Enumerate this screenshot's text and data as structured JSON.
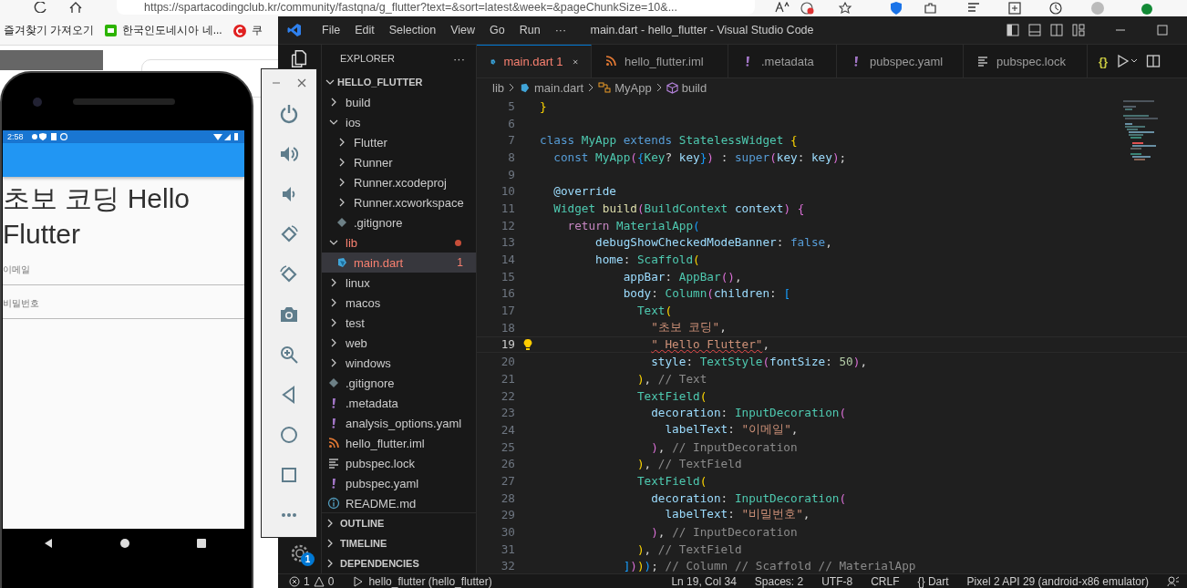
{
  "browser": {
    "url": "https://spartacodingclub.kr/community/fastqna/g_flutter?text=&sort=latest&week=&pageChunkSize=10&...",
    "bookmarks": [
      {
        "label": "즐겨찾기 가져오기",
        "kind": "plain"
      },
      {
        "label": "한국인도네시아 네...",
        "kind": "green"
      },
      {
        "label": "쿠",
        "kind": "red"
      }
    ]
  },
  "phone": {
    "time": "2:58",
    "title": "초보 코딩 Hello Flutter",
    "fields": [
      {
        "label": "이메일"
      },
      {
        "label": "비밀번호"
      }
    ]
  },
  "vscode": {
    "menu": [
      "File",
      "Edit",
      "Selection",
      "View",
      "Go",
      "Run",
      "···"
    ],
    "title": "main.dart - hello_flutter - Visual Studio Code",
    "activity_bar": {
      "settings_badge": "1"
    },
    "explorer": {
      "title": "EXPLORER",
      "more": "···",
      "root": {
        "label": "HELLO_FLUTTER",
        "expanded": true,
        "children": [
          {
            "label": "build",
            "kind": "folder",
            "expanded": false,
            "selected": false,
            "error": false
          },
          {
            "label": "ios",
            "kind": "folder",
            "expanded": true,
            "selected": false,
            "error": false,
            "children": [
              {
                "label": "Flutter",
                "kind": "folder",
                "expanded": false,
                "selected": false,
                "error": false
              },
              {
                "label": "Runner",
                "kind": "folder",
                "expanded": false,
                "selected": false,
                "error": false
              },
              {
                "label": "Runner.xcodeproj",
                "kind": "folder",
                "expanded": false,
                "selected": false,
                "error": false
              },
              {
                "label": "Runner.xcworkspace",
                "kind": "folder",
                "expanded": false,
                "selected": false,
                "error": false
              },
              {
                "label": ".gitignore",
                "kind": "git",
                "selected": false,
                "error": false
              }
            ]
          },
          {
            "label": "lib",
            "kind": "folder",
            "expanded": true,
            "selected": false,
            "error": true,
            "children": [
              {
                "label": "main.dart",
                "kind": "dart",
                "selected": true,
                "error": true,
                "badge": "1"
              }
            ]
          },
          {
            "label": "linux",
            "kind": "folder",
            "expanded": false,
            "selected": false,
            "error": false
          },
          {
            "label": "macos",
            "kind": "folder",
            "expanded": false,
            "selected": false,
            "error": false
          },
          {
            "label": "test",
            "kind": "folder",
            "expanded": false,
            "selected": false,
            "error": false
          },
          {
            "label": "web",
            "kind": "folder",
            "expanded": false,
            "selected": false,
            "error": false
          },
          {
            "label": "windows",
            "kind": "folder",
            "expanded": false,
            "selected": false,
            "error": false
          },
          {
            "label": ".gitignore",
            "kind": "git",
            "selected": false,
            "error": false
          },
          {
            "label": ".metadata",
            "kind": "exclaim",
            "selected": false,
            "error": false
          },
          {
            "label": "analysis_options.yaml",
            "kind": "exclaim",
            "selected": false,
            "error": false
          },
          {
            "label": "hello_flutter.iml",
            "kind": "rss",
            "selected": false,
            "error": false
          },
          {
            "label": "pubspec.lock",
            "kind": "lines",
            "selected": false,
            "error": false
          },
          {
            "label": "pubspec.yaml",
            "kind": "exclaim",
            "selected": false,
            "error": false
          },
          {
            "label": "README.md",
            "kind": "info",
            "selected": false,
            "error": false
          }
        ]
      },
      "sections": [
        {
          "label": "OUTLINE",
          "expanded": false
        },
        {
          "label": "TIMELINE",
          "expanded": false
        },
        {
          "label": "DEPENDENCIES",
          "expanded": false
        }
      ]
    },
    "tabs": [
      {
        "label": "main.dart",
        "badge": "1",
        "kind": "dart",
        "selected": true,
        "error": true
      },
      {
        "label": "hello_flutter.iml",
        "kind": "rss",
        "selected": false,
        "error": false
      },
      {
        "label": ".metadata",
        "kind": "exclaim",
        "selected": false,
        "error": false
      },
      {
        "label": "pubspec.yaml",
        "kind": "exclaim",
        "selected": false,
        "error": false
      },
      {
        "label": "pubspec.lock",
        "kind": "lines",
        "selected": false,
        "error": false
      }
    ],
    "editor_actions": {
      "braces": "{}"
    },
    "breadcrumbs": [
      {
        "label": "lib",
        "kind": "folder"
      },
      {
        "label": "main.dart",
        "kind": "dart"
      },
      {
        "label": "MyApp",
        "kind": "class"
      },
      {
        "label": "build",
        "kind": "method"
      }
    ],
    "code": [
      {
        "number": "5",
        "current": false,
        "tokens": [
          {
            "text": "}",
            "kind": "b1"
          }
        ]
      },
      {
        "number": "6",
        "current": false
      },
      {
        "number": "7",
        "current": false,
        "tokens": [
          {
            "text": "class ",
            "kind": "kw"
          },
          {
            "text": "MyApp ",
            "kind": "ty"
          },
          {
            "text": "extends ",
            "kind": "kw"
          },
          {
            "text": "StatelessWidget ",
            "kind": "ty"
          },
          {
            "text": "{",
            "kind": "b1"
          }
        ]
      },
      {
        "number": "8",
        "current": false,
        "tokens": [
          {
            "text": "  const ",
            "kind": "kw"
          },
          {
            "text": "MyApp",
            "kind": "ty"
          },
          {
            "text": "(",
            "kind": "b2"
          },
          {
            "text": "{",
            "kind": "b3"
          },
          {
            "text": "Key",
            "kind": "ty"
          },
          {
            "text": "? ",
            "kind": "p"
          },
          {
            "text": "key",
            "kind": "va"
          },
          {
            "text": "}",
            "kind": "b3"
          },
          {
            "text": ")",
            "kind": "b2"
          },
          {
            "text": " : ",
            "kind": "p"
          },
          {
            "text": "super",
            "kind": "kw"
          },
          {
            "text": "(",
            "kind": "b2"
          },
          {
            "text": "key",
            "kind": "va"
          },
          {
            "text": ": ",
            "kind": "p"
          },
          {
            "text": "key",
            "kind": "va"
          },
          {
            "text": ")",
            "kind": "b2"
          },
          {
            "text": ";",
            "kind": "p"
          }
        ]
      },
      {
        "number": "9",
        "current": false
      },
      {
        "number": "10",
        "current": false,
        "tokens": [
          {
            "text": "  @override",
            "kind": "va"
          }
        ]
      },
      {
        "number": "11",
        "current": false,
        "tokens": [
          {
            "text": "  Widget ",
            "kind": "ty"
          },
          {
            "text": "build",
            "kind": "fn"
          },
          {
            "text": "(",
            "kind": "b2"
          },
          {
            "text": "BuildContext ",
            "kind": "ty"
          },
          {
            "text": "context",
            "kind": "va"
          },
          {
            "text": ") ",
            "kind": "b2"
          },
          {
            "text": "{",
            "kind": "b2"
          }
        ]
      },
      {
        "number": "12",
        "current": false,
        "tokens": [
          {
            "text": "    return ",
            "kind": "ctl"
          },
          {
            "text": "MaterialApp",
            "kind": "ty"
          },
          {
            "text": "(",
            "kind": "b3"
          }
        ]
      },
      {
        "number": "13",
        "current": false,
        "tokens": [
          {
            "text": "        debugShowCheckedModeBanner",
            "kind": "va"
          },
          {
            "text": ": ",
            "kind": "p"
          },
          {
            "text": "false",
            "kind": "kw"
          },
          {
            "text": ",",
            "kind": "p"
          }
        ]
      },
      {
        "number": "14",
        "current": false,
        "tokens": [
          {
            "text": "        home",
            "kind": "va"
          },
          {
            "text": ": ",
            "kind": "p"
          },
          {
            "text": "Scaffold",
            "kind": "ty"
          },
          {
            "text": "(",
            "kind": "b1"
          }
        ]
      },
      {
        "number": "15",
        "current": false,
        "tokens": [
          {
            "text": "            appBar",
            "kind": "va"
          },
          {
            "text": ": ",
            "kind": "p"
          },
          {
            "text": "AppBar",
            "kind": "ty"
          },
          {
            "text": "()",
            "kind": "b2"
          },
          {
            "text": ",",
            "kind": "p"
          }
        ]
      },
      {
        "number": "16",
        "current": false,
        "tokens": [
          {
            "text": "            body",
            "kind": "va"
          },
          {
            "text": ": ",
            "kind": "p"
          },
          {
            "text": "Column",
            "kind": "ty"
          },
          {
            "text": "(",
            "kind": "b2"
          },
          {
            "text": "children",
            "kind": "va"
          },
          {
            "text": ": ",
            "kind": "p"
          },
          {
            "text": "[",
            "kind": "b3"
          }
        ]
      },
      {
        "number": "17",
        "current": false,
        "tokens": [
          {
            "text": "              Text",
            "kind": "ty"
          },
          {
            "text": "(",
            "kind": "b1"
          }
        ]
      },
      {
        "number": "18",
        "current": false,
        "tokens": [
          {
            "text": "                \"초보 코딩\"",
            "kind": "st"
          },
          {
            "text": ",",
            "kind": "p"
          }
        ]
      },
      {
        "number": "19",
        "current": true,
        "tokens": [
          {
            "text": "                \" Hello Flutter\"",
            "kind": "er"
          },
          {
            "text": ",",
            "kind": "p"
          }
        ]
      },
      {
        "number": "20",
        "current": false,
        "tokens": [
          {
            "text": "                style",
            "kind": "va"
          },
          {
            "text": ": ",
            "kind": "p"
          },
          {
            "text": "TextStyle",
            "kind": "ty"
          },
          {
            "text": "(",
            "kind": "b2"
          },
          {
            "text": "fontSize",
            "kind": "va"
          },
          {
            "text": ": ",
            "kind": "p"
          },
          {
            "text": "50",
            "kind": "nu"
          },
          {
            "text": ")",
            "kind": "b2"
          },
          {
            "text": ",",
            "kind": "p"
          }
        ]
      },
      {
        "number": "21",
        "current": false,
        "tokens": [
          {
            "text": "              )",
            "kind": "b1"
          },
          {
            "text": ", ",
            "kind": "p"
          },
          {
            "text": "// Text",
            "kind": "cm"
          }
        ]
      },
      {
        "number": "22",
        "current": false,
        "tokens": [
          {
            "text": "              TextField",
            "kind": "ty"
          },
          {
            "text": "(",
            "kind": "b1"
          }
        ]
      },
      {
        "number": "23",
        "current": false,
        "tokens": [
          {
            "text": "                decoration",
            "kind": "va"
          },
          {
            "text": ": ",
            "kind": "p"
          },
          {
            "text": "InputDecoration",
            "kind": "ty"
          },
          {
            "text": "(",
            "kind": "b2"
          }
        ]
      },
      {
        "number": "24",
        "current": false,
        "tokens": [
          {
            "text": "                  labelText",
            "kind": "va"
          },
          {
            "text": ": ",
            "kind": "p"
          },
          {
            "text": "\"이메일\"",
            "kind": "st"
          },
          {
            "text": ",",
            "kind": "p"
          }
        ]
      },
      {
        "number": "25",
        "current": false,
        "tokens": [
          {
            "text": "                )",
            "kind": "b2"
          },
          {
            "text": ", ",
            "kind": "p"
          },
          {
            "text": "// InputDecoration",
            "kind": "cm"
          }
        ]
      },
      {
        "number": "26",
        "current": false,
        "tokens": [
          {
            "text": "              )",
            "kind": "b1"
          },
          {
            "text": ", ",
            "kind": "p"
          },
          {
            "text": "// TextField",
            "kind": "cm"
          }
        ]
      },
      {
        "number": "27",
        "current": false,
        "tokens": [
          {
            "text": "              TextField",
            "kind": "ty"
          },
          {
            "text": "(",
            "kind": "b1"
          }
        ]
      },
      {
        "number": "28",
        "current": false,
        "tokens": [
          {
            "text": "                decoration",
            "kind": "va"
          },
          {
            "text": ": ",
            "kind": "p"
          },
          {
            "text": "InputDecoration",
            "kind": "ty"
          },
          {
            "text": "(",
            "kind": "b2"
          }
        ]
      },
      {
        "number": "29",
        "current": false,
        "tokens": [
          {
            "text": "                  labelText",
            "kind": "va"
          },
          {
            "text": ": ",
            "kind": "p"
          },
          {
            "text": "\"비밀번호\"",
            "kind": "st"
          },
          {
            "text": ",",
            "kind": "p"
          }
        ]
      },
      {
        "number": "30",
        "current": false,
        "tokens": [
          {
            "text": "                )",
            "kind": "b2"
          },
          {
            "text": ", ",
            "kind": "p"
          },
          {
            "text": "// InputDecoration",
            "kind": "cm"
          }
        ]
      },
      {
        "number": "31",
        "current": false,
        "tokens": [
          {
            "text": "              )",
            "kind": "b1"
          },
          {
            "text": ", ",
            "kind": "p"
          },
          {
            "text": "// TextField",
            "kind": "cm"
          }
        ]
      },
      {
        "number": "32",
        "current": false,
        "tokens": [
          {
            "text": "            ]",
            "kind": "b3"
          },
          {
            "text": ")",
            "kind": "b2"
          },
          {
            "text": ")",
            "kind": "b1"
          },
          {
            "text": ")",
            "kind": "b3"
          },
          {
            "text": ";",
            "kind": "p"
          },
          {
            "text": " // Column // Scaffold // MaterialApp",
            "kind": "cm"
          }
        ]
      }
    ],
    "status_bar": {
      "errors": "1",
      "warnings": "0",
      "target": "hello_flutter (hello_flutter)",
      "right": [
        {
          "label": "Ln 19, Col 34",
          "kind": "text"
        },
        {
          "label": "Spaces: 2",
          "kind": "text"
        },
        {
          "label": "UTF-8",
          "kind": "text"
        },
        {
          "label": "CRLF",
          "kind": "text"
        },
        {
          "label": "Dart",
          "kind": "language",
          "icon": "{}"
        },
        {
          "label": "Pixel 2 API 29 (android-x86 emulator)",
          "kind": "text"
        }
      ]
    }
  }
}
